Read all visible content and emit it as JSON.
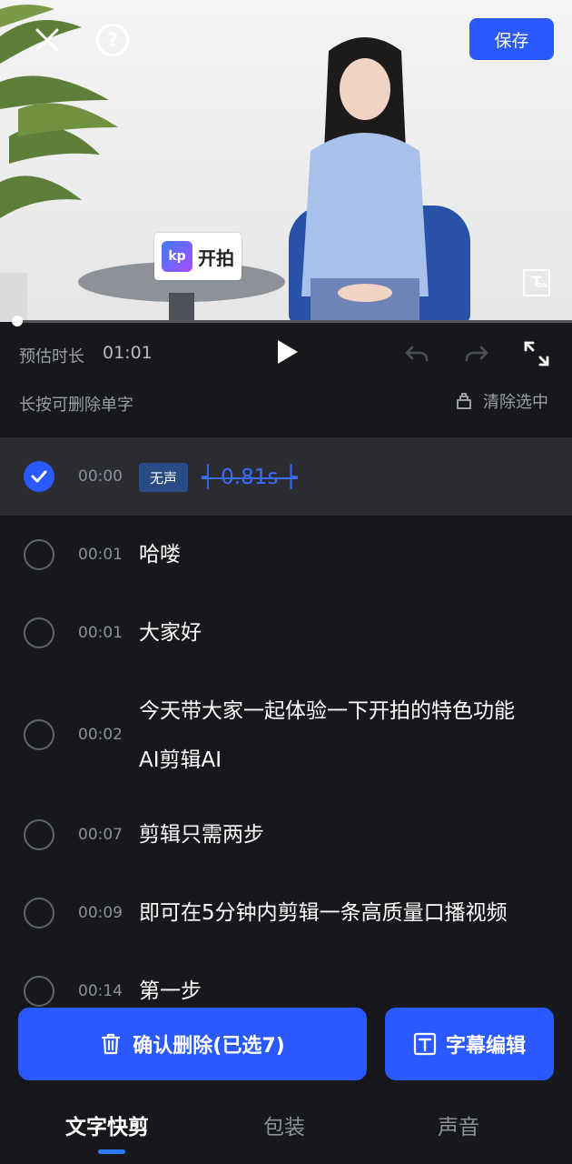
{
  "header": {
    "save_label": "保存"
  },
  "video": {
    "brand_text": "开拍",
    "brand_mark": "kp",
    "subtitle_toggle_icon": "T",
    "subtitle_toggle_state": "ON",
    "playback_progress": 0.0
  },
  "controls": {
    "duration_label": "预估时长",
    "duration_value": "01:01",
    "hint": "长按可删除单字",
    "clear_selection": "清除选中"
  },
  "transcript": [
    {
      "time": "00:00",
      "selected": true,
      "silent": true,
      "silent_tag": "无声",
      "silent_duration": "0.81s"
    },
    {
      "time": "00:01",
      "selected": false,
      "lines": [
        "哈喽"
      ]
    },
    {
      "time": "00:01",
      "selected": false,
      "lines": [
        "大家好"
      ]
    },
    {
      "time": "00:02",
      "selected": false,
      "lines": [
        "今天带大家一起体验一下开拍的特色功能",
        "AI剪辑AI"
      ]
    },
    {
      "time": "00:07",
      "selected": false,
      "lines": [
        "剪辑只需两步"
      ]
    },
    {
      "time": "00:09",
      "selected": false,
      "lines": [
        "即可在5分钟内剪辑一条高质量口播视频"
      ]
    },
    {
      "time": "00:14",
      "selected": false,
      "lines": [
        "第一步"
      ]
    }
  ],
  "actions": {
    "confirm_delete": "确认删除(已选7)",
    "subtitle_edit": "字幕编辑"
  },
  "tabs": [
    {
      "label": "文字快剪",
      "active": true
    },
    {
      "label": "包装",
      "active": false
    },
    {
      "label": "声音",
      "active": false
    }
  ],
  "colors": {
    "accent": "#2a59ff",
    "background": "#17181c",
    "selected_row": "#2a2c32"
  }
}
